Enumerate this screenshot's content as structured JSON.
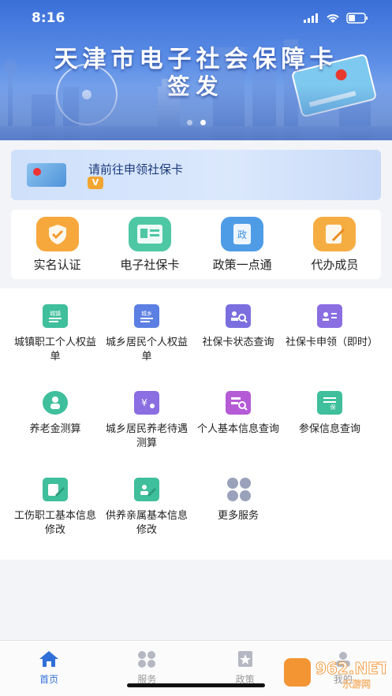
{
  "status_bar": {
    "time": "8:16"
  },
  "banner": {
    "title_line1": "天津市电子社会保障卡",
    "title_line2": "签发",
    "slides": 2,
    "active_slide": 2
  },
  "notice": {
    "text": "请前往申领社保卡",
    "badge": "V"
  },
  "quick_actions": [
    {
      "label": "实名认证",
      "icon": "shield-check-icon",
      "color": "#f29a2e"
    },
    {
      "label": "电子社保卡",
      "icon": "id-card-icon",
      "color": "#3fc0a0"
    },
    {
      "label": "政策一点通",
      "icon": "policy-doc-icon",
      "color": "#3b8fe0"
    },
    {
      "label": "代办成员",
      "icon": "pencil-doc-icon",
      "color": "#f3a53a"
    }
  ],
  "services": [
    {
      "label": "城镇职工个人权益单",
      "icon": "urban-sheet-icon",
      "tag": "城镇",
      "color": "#3fbf9b"
    },
    {
      "label": "城乡居民个人权益单",
      "icon": "rural-sheet-icon",
      "tag": "城乡",
      "color": "#5b7fe3"
    },
    {
      "label": "社保卡状态查询",
      "icon": "card-search-icon",
      "tag": "",
      "color": "#7b6fe0"
    },
    {
      "label": "社保卡申领（即时）",
      "icon": "card-apply-icon",
      "tag": "",
      "color": "#8a6ee2"
    },
    {
      "label": "养老金测算",
      "icon": "pension-calc-icon",
      "tag": "",
      "color": "#3fbf9b"
    },
    {
      "label": "城乡居民养老待遇测算",
      "icon": "rural-pension-icon",
      "tag": "",
      "color": "#8a6ee2"
    },
    {
      "label": "个人基本信息查询",
      "icon": "person-search-icon",
      "tag": "",
      "color": "#b55bd6"
    },
    {
      "label": "参保信息查询",
      "icon": "insured-info-icon",
      "tag": "保",
      "color": "#3fbf9b"
    },
    {
      "label": "工伤职工基本信息修改",
      "icon": "injury-edit-icon",
      "tag": "",
      "color": "#3fbf9b"
    },
    {
      "label": "供养亲属基本信息修改",
      "icon": "family-edit-icon",
      "tag": "",
      "color": "#3fbf9b"
    },
    {
      "label": "更多服务",
      "icon": "more-grid-icon",
      "tag": "",
      "color": "#9aa2bb"
    }
  ],
  "tabs": [
    {
      "label": "首页",
      "icon": "home-icon",
      "active": true
    },
    {
      "label": "服务",
      "icon": "grid-icon",
      "active": false
    },
    {
      "label": "政策",
      "icon": "policy-icon",
      "active": false
    },
    {
      "label": "我的",
      "icon": "profile-icon",
      "active": false
    }
  ],
  "watermark": {
    "brand": "962.NET",
    "sub": "乐游网"
  },
  "colors": {
    "accent": "#2f6fd6",
    "tab_inactive": "#999999"
  }
}
